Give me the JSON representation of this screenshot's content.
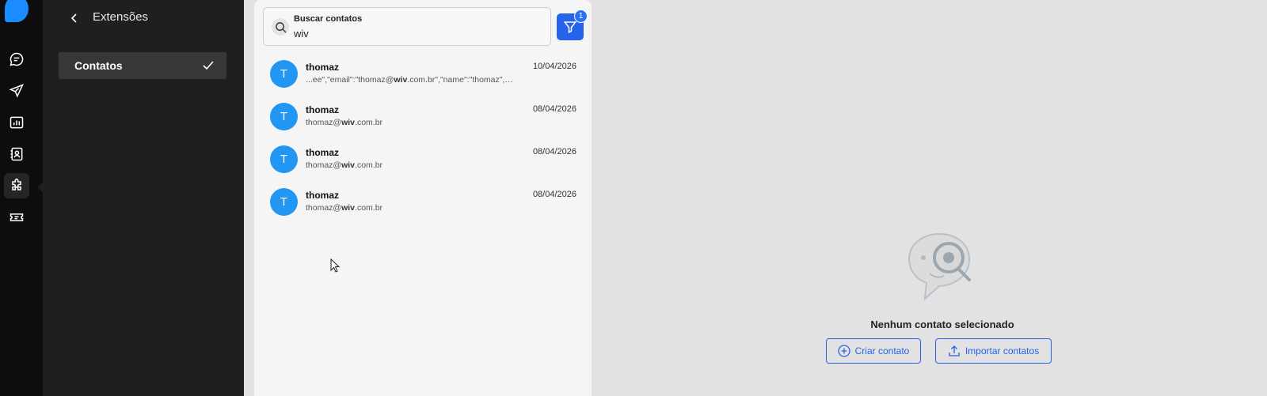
{
  "rail": {
    "icons": [
      "chat-icon",
      "send-icon",
      "chart-icon",
      "contacts-icon",
      "extensions-icon",
      "ticket-icon"
    ],
    "active": "extensions-icon"
  },
  "extensions": {
    "title": "Extensões",
    "items": [
      {
        "label": "Contatos",
        "checked": true
      }
    ]
  },
  "search": {
    "label": "Buscar contatos",
    "value": "wiv",
    "filter_count": "1"
  },
  "contacts": [
    {
      "initial": "T",
      "name": "thomaz",
      "sub_pre": "...ee\",\"email\":\"thomaz@",
      "sub_match": "wiv",
      "sub_post": ".com.br\",\"name\":\"thomaz\",\"m...",
      "date": "10/04/2026"
    },
    {
      "initial": "T",
      "name": "thomaz",
      "sub_pre": "thomaz@",
      "sub_match": "wiv",
      "sub_post": ".com.br",
      "date": "08/04/2026"
    },
    {
      "initial": "T",
      "name": "thomaz",
      "sub_pre": "thomaz@",
      "sub_match": "wiv",
      "sub_post": ".com.br",
      "date": "08/04/2026"
    },
    {
      "initial": "T",
      "name": "thomaz",
      "sub_pre": "thomaz@",
      "sub_match": "wiv",
      "sub_post": ".com.br",
      "date": "08/04/2026"
    }
  ],
  "empty_state": {
    "message": "Nenhum contato selecionado",
    "create_label": "Criar contato",
    "import_label": "Importar contatos"
  },
  "colors": {
    "accent": "#2563eb",
    "avatar": "#2196f3",
    "rail_bg": "#0d0d0d",
    "panel_bg": "#1f1f1f"
  }
}
